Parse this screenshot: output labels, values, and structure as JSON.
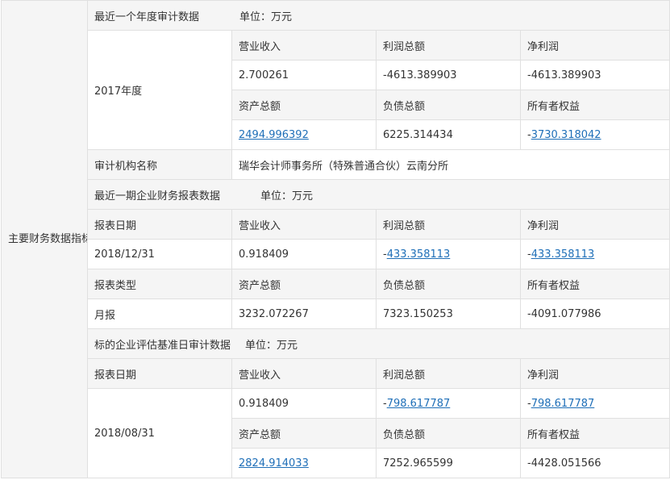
{
  "main_label": "主要财务数据指标",
  "unit_prefix": "单位：",
  "annual": {
    "section_title": "最近一个年度审计数据",
    "unit": "万元",
    "period": "2017年度",
    "headers_row1": [
      "营业收入",
      "利润总额",
      "净利润"
    ],
    "values_row1": [
      "2.700261",
      "-4613.389903",
      "-4613.389903"
    ],
    "headers_row2": [
      "资产总额",
      "负债总额",
      "所有者权益"
    ],
    "values_row2": {
      "total_assets": "2494.996392",
      "total_liabilities": "6225.314434",
      "equity_sign": "-",
      "equity_value": "3730.318042"
    },
    "audit_firm_label": "审计机构名称",
    "audit_firm_name": "瑞华会计师事务所（特殊普通合伙）云南分所"
  },
  "latest": {
    "section_title": "最近一期企业财务报表数据",
    "unit": "万元",
    "date_label": "报表日期",
    "date_value": "2018/12/31",
    "type_label": "报表类型",
    "type_value": "月报",
    "headers_row1": [
      "营业收入",
      "利润总额",
      "净利润"
    ],
    "revenue": "0.918409",
    "profit_sign": "-",
    "profit_value": "433.358113",
    "net_sign": "-",
    "net_value": "433.358113",
    "headers_row2": [
      "资产总额",
      "负债总额",
      "所有者权益"
    ],
    "values_row2": [
      "3232.072267",
      "7323.150253",
      "-4091.077986"
    ]
  },
  "benchmark": {
    "section_title": "标的企业评估基准日审计数据",
    "unit": "万元",
    "date_label": "报表日期",
    "date_value": "2018/08/31",
    "headers_row1": [
      "营业收入",
      "利润总额",
      "净利润"
    ],
    "revenue": "0.918409",
    "profit_sign": "-",
    "profit_value": "798.617787",
    "net_sign": "-",
    "net_value": "798.617787",
    "headers_row2": [
      "资产总额",
      "负债总额",
      "所有者权益"
    ],
    "total_assets": "2824.914033",
    "total_liabilities": "7252.965599",
    "equity": "-4428.051566"
  }
}
